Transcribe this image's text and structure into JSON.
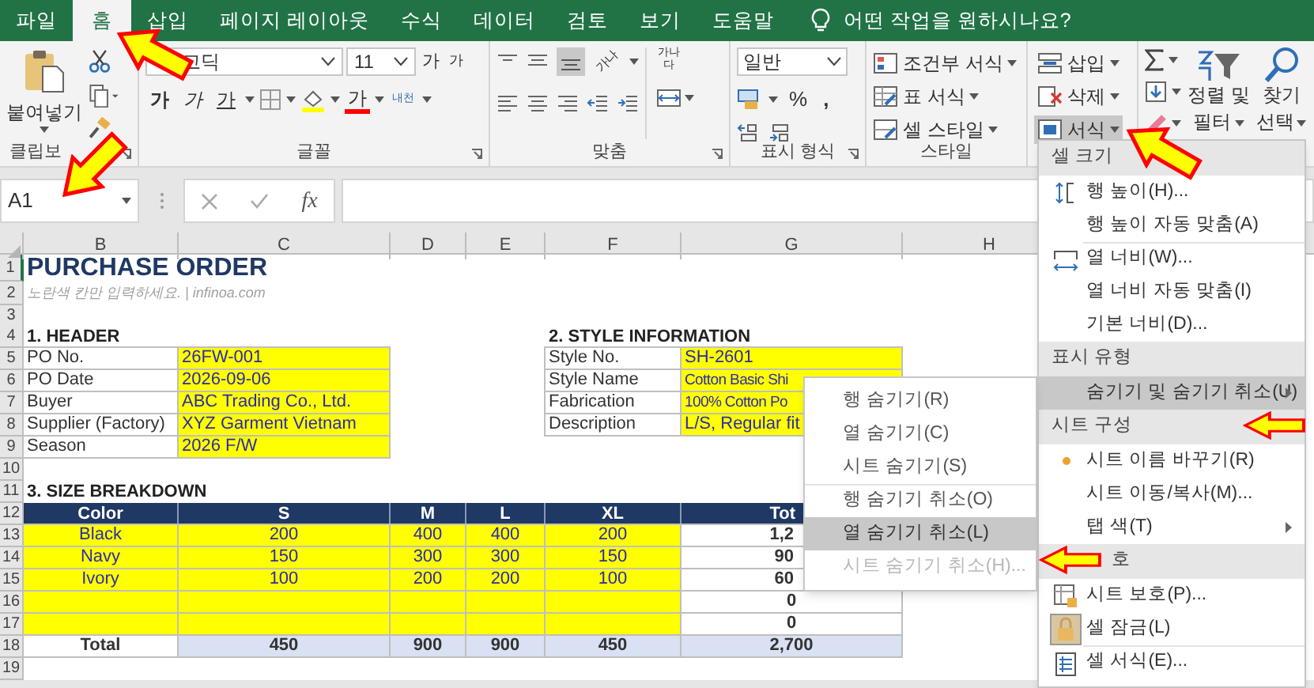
{
  "tabs": [
    {
      "label": "파일",
      "selected": false
    },
    {
      "label": "홈",
      "selected": true
    },
    {
      "label": "삽입",
      "selected": false
    },
    {
      "label": "페이지 레이아웃",
      "selected": false
    },
    {
      "label": "수식",
      "selected": false
    },
    {
      "label": "데이터",
      "selected": false
    },
    {
      "label": "검토",
      "selected": false
    },
    {
      "label": "보기",
      "selected": false
    },
    {
      "label": "도움말",
      "selected": false
    }
  ],
  "tell_me": "어떤 작업을 원하시나요?",
  "ribbon": {
    "clipboard": {
      "paste": "붙여넣기",
      "label": "클립보"
    },
    "font": {
      "name": "고딕",
      "size": "11",
      "grow": "가",
      "shrink": "가",
      "bold": "가",
      "italic": "가",
      "underline": "가",
      "font_color": "가",
      "phonetic": "내천",
      "label": "글꼴"
    },
    "alignment": {
      "orientation": "가나",
      "wrap": "가나다",
      "label": "맞춤"
    },
    "number": {
      "format": "일반",
      "percent": "%",
      "comma": ",",
      "label": "표시 형식"
    },
    "styles": {
      "items": [
        "조건부 서식",
        "표 서식",
        "셀 스타일"
      ],
      "label": "스타일"
    },
    "cells": {
      "items": [
        {
          "label": "삽입",
          "selected": false
        },
        {
          "label": "삭제",
          "selected": false
        },
        {
          "label": "서식",
          "selected": true
        }
      ]
    },
    "editing": {
      "sort": [
        "정렬 및",
        "필터"
      ],
      "find": [
        "찾기",
        "선택"
      ]
    }
  },
  "formula_bar": {
    "name_box": "A1",
    "function_label": "fx"
  },
  "sheet": {
    "columns": [
      "B",
      "C",
      "D",
      "E",
      "F",
      "G",
      "H"
    ],
    "rows": [
      {
        "number": "1",
        "cells": [
          {
            "text": "PURCHASE ORDER",
            "kind": "title"
          },
          null,
          null,
          null,
          null,
          null,
          null
        ]
      },
      {
        "number": "2",
        "cells": [
          {
            "text": "노란색 칸만 입력하세요.  |  infinoa.com",
            "kind": "note"
          },
          null,
          null,
          null,
          null,
          null,
          null
        ]
      },
      {
        "number": "3",
        "cells": [
          null,
          null,
          null,
          null,
          null,
          null,
          null
        ]
      },
      {
        "number": "4",
        "cells": [
          {
            "text": "1. HEADER",
            "kind": "section"
          },
          null,
          null,
          null,
          {
            "text": "2. STYLE INFORMATION",
            "kind": "section"
          },
          null,
          null
        ]
      },
      {
        "number": "5",
        "cells": [
          {
            "text": "PO No.",
            "kind": "label"
          },
          {
            "text": "26FW-001",
            "kind": "input"
          },
          null,
          null,
          {
            "text": "Style No.",
            "kind": "label"
          },
          {
            "text": "SH-2601",
            "kind": "input"
          },
          null
        ]
      },
      {
        "number": "6",
        "cells": [
          {
            "text": "PO Date",
            "kind": "label"
          },
          {
            "text": "2026-09-06",
            "kind": "input"
          },
          null,
          null,
          {
            "text": "Style Name",
            "kind": "label"
          },
          {
            "text": "Cotton Basic Shi",
            "kind": "inputcut"
          },
          null
        ]
      },
      {
        "number": "7",
        "cells": [
          {
            "text": "Buyer",
            "kind": "label"
          },
          {
            "text": "ABC Trading Co., Ltd.",
            "kind": "input"
          },
          null,
          null,
          {
            "text": "Fabrication",
            "kind": "label"
          },
          {
            "text": "100% Cotton Po",
            "kind": "inputcut"
          },
          null
        ]
      },
      {
        "number": "8",
        "cells": [
          {
            "text": "Supplier (Factory)",
            "kind": "label"
          },
          {
            "text": "XYZ Garment Vietnam",
            "kind": "input"
          },
          null,
          null,
          {
            "text": "Description",
            "kind": "label"
          },
          {
            "text": "L/S, Regular fit",
            "kind": "input"
          },
          null
        ]
      },
      {
        "number": "9",
        "cells": [
          {
            "text": "Season",
            "kind": "label"
          },
          {
            "text": "2026 F/W",
            "kind": "input"
          },
          null,
          null,
          null,
          null,
          null
        ]
      },
      {
        "number": "10",
        "cells": [
          null,
          null,
          null,
          null,
          null,
          null,
          null
        ]
      },
      {
        "number": "11",
        "cells": [
          {
            "text": "3. SIZE BREAKDOWN",
            "kind": "section"
          },
          null,
          null,
          null,
          null,
          null,
          null
        ]
      },
      {
        "number": "12",
        "cells": [
          {
            "text": "Color",
            "kind": "head"
          },
          {
            "text": "S",
            "kind": "head"
          },
          {
            "text": "M",
            "kind": "head"
          },
          {
            "text": "L",
            "kind": "head"
          },
          {
            "text": "XL",
            "kind": "head"
          },
          {
            "text": "Tot",
            "kind": "headcut"
          },
          null
        ]
      },
      {
        "number": "13",
        "cells": [
          {
            "text": "Black",
            "kind": "entry"
          },
          {
            "text": "200",
            "kind": "entry"
          },
          {
            "text": "400",
            "kind": "entry"
          },
          {
            "text": "400",
            "kind": "entry"
          },
          {
            "text": "200",
            "kind": "entry"
          },
          {
            "text": "1,2",
            "kind": "calccut"
          },
          null
        ]
      },
      {
        "number": "14",
        "cells": [
          {
            "text": "Navy",
            "kind": "entry"
          },
          {
            "text": "150",
            "kind": "entry"
          },
          {
            "text": "300",
            "kind": "entry"
          },
          {
            "text": "300",
            "kind": "entry"
          },
          {
            "text": "150",
            "kind": "entry"
          },
          {
            "text": "90",
            "kind": "calccut"
          },
          null
        ]
      },
      {
        "number": "15",
        "cells": [
          {
            "text": "Ivory",
            "kind": "entry"
          },
          {
            "text": "100",
            "kind": "entry"
          },
          {
            "text": "200",
            "kind": "entry"
          },
          {
            "text": "200",
            "kind": "entry"
          },
          {
            "text": "100",
            "kind": "entry"
          },
          {
            "text": "60",
            "kind": "calccut"
          },
          null
        ]
      },
      {
        "number": "16",
        "cells": [
          {
            "kind": "entry"
          },
          {
            "kind": "entry"
          },
          {
            "kind": "entry"
          },
          {
            "kind": "entry"
          },
          {
            "kind": "entry"
          },
          {
            "text": "0",
            "kind": "calc"
          },
          null
        ]
      },
      {
        "number": "17",
        "cells": [
          {
            "kind": "entry"
          },
          {
            "kind": "entry"
          },
          {
            "kind": "entry"
          },
          {
            "kind": "entry"
          },
          {
            "kind": "entry"
          },
          {
            "text": "0",
            "kind": "calc"
          },
          null
        ]
      },
      {
        "number": "18",
        "cells": [
          {
            "text": "Total",
            "kind": "calc"
          },
          {
            "text": "450",
            "kind": "total"
          },
          {
            "text": "900",
            "kind": "total"
          },
          {
            "text": "900",
            "kind": "total"
          },
          {
            "text": "450",
            "kind": "total"
          },
          {
            "text": "2,700",
            "kind": "total"
          },
          null
        ]
      },
      {
        "number": "19",
        "cells": [
          null,
          null,
          null,
          null,
          null,
          null,
          null
        ]
      }
    ]
  },
  "format_menu": [
    {
      "label": "셀 크기",
      "kind": "header"
    },
    {
      "label": "행 높이(H)...",
      "kind": "rowheight",
      "selected": false
    },
    {
      "label": "행 높이 자동 맞춤(A)",
      "kind": "item",
      "selected": false
    },
    {
      "label": "열 너비(W)...",
      "kind": "colwidth",
      "selected": false,
      "divider": true
    },
    {
      "label": "열 너비 자동 맞춤(I)",
      "kind": "item",
      "selected": false
    },
    {
      "label": "기본 너비(D)...",
      "kind": "item",
      "selected": false
    },
    {
      "label": "표시 유형",
      "kind": "header"
    },
    {
      "label": "숨기기 및 숨기기 취소(U)",
      "kind": "submenu",
      "selected": true
    },
    {
      "label": "시트 구성",
      "kind": "header"
    },
    {
      "label": "시트 이름 바꾸기(R)",
      "kind": "bullet",
      "selected": false
    },
    {
      "label": "시트 이동/복사(M)...",
      "kind": "item",
      "selected": false
    },
    {
      "label": "탭 색(T)",
      "kind": "submenu",
      "selected": false
    },
    {
      "label": "호",
      "kind": "header"
    },
    {
      "label": "시트 보호(P)...",
      "kind": "protect",
      "selected": false
    },
    {
      "label": "셀 잠금(L)",
      "kind": "lock",
      "selected": false
    },
    {
      "label": "셀 서식(E)...",
      "kind": "format",
      "selected": false,
      "divider": true
    }
  ],
  "hide_menu": [
    {
      "label": "행 숨기기(R)",
      "selected": false,
      "disabled": false
    },
    {
      "label": "열 숨기기(C)",
      "selected": false,
      "disabled": false
    },
    {
      "label": "시트 숨기기(S)",
      "selected": false,
      "disabled": false
    },
    {
      "label": "행 숨기기 취소(O)",
      "selected": false,
      "disabled": false,
      "divider": true
    },
    {
      "label": "열 숨기기 취소(L)",
      "selected": true,
      "disabled": false
    },
    {
      "label": "시트 숨기기 취소(H)...",
      "selected": false,
      "disabled": true
    }
  ]
}
